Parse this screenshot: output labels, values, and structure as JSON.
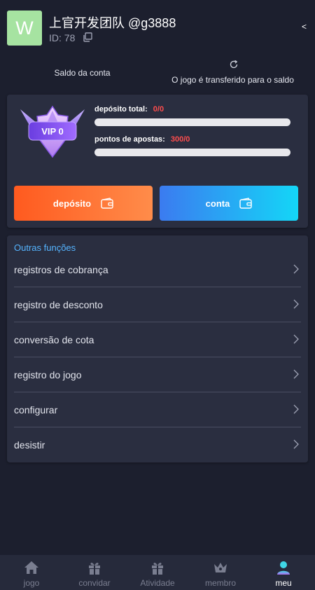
{
  "header": {
    "avatar_letter": "W",
    "user_name": "上官开发团队 @g3888",
    "user_id": "ID: 78",
    "back": "<"
  },
  "balance": {
    "saldo_label": "Saldo da conta",
    "transfer_label": "O jogo é transferido para o saldo"
  },
  "vip": {
    "level": "VIP 0",
    "deposit_label": "depósito total:",
    "deposit_value": "0/0",
    "deposit_progress": 0,
    "bets_label": "pontos de apostas:",
    "bets_value": "300/0",
    "bets_progress": 0,
    "deposit_button": "depósito",
    "account_button": "conta"
  },
  "functions": {
    "title": "Outras funções",
    "items": [
      {
        "label": "registros de cobrança"
      },
      {
        "label": "registro de desconto"
      },
      {
        "label": "conversão de cota"
      },
      {
        "label": "registro do jogo"
      },
      {
        "label": "configurar"
      },
      {
        "label": "desistir"
      }
    ]
  },
  "nav": {
    "items": [
      {
        "label": "jogo",
        "icon": "house-icon"
      },
      {
        "label": "convidar",
        "icon": "gift-icon"
      },
      {
        "label": "Atividade",
        "icon": "gift-icon"
      },
      {
        "label": "membro",
        "icon": "crown-icon"
      },
      {
        "label": "meu",
        "icon": "user-icon"
      }
    ],
    "active": "meu"
  },
  "colors": {
    "background": "#1c1f2e",
    "card": "#2a2e40",
    "accent_blue": "#55b4ff",
    "value_red": "#ff4d4d",
    "deposit_button": "#ff5a1f",
    "account_button": "#14d6f7"
  }
}
